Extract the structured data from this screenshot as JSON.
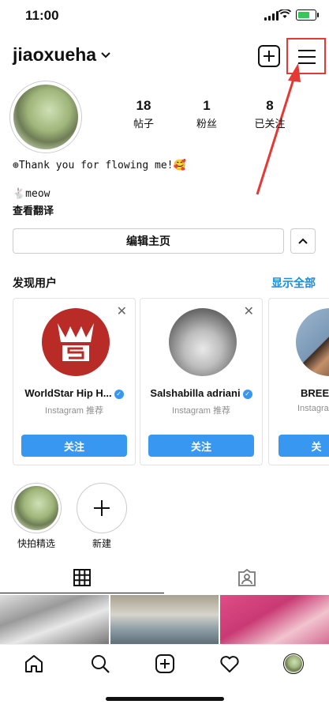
{
  "status": {
    "time": "11:00"
  },
  "header": {
    "username": "jiaoxueha"
  },
  "stats": [
    {
      "value": "18",
      "label": "帖子"
    },
    {
      "value": "1",
      "label": "粉丝"
    },
    {
      "value": "8",
      "label": "已关注"
    }
  ],
  "bio": {
    "line1": "⊕Thank you for flowing me!🥰",
    "line2": "🐇meow",
    "translate": "查看翻译"
  },
  "edit": {
    "label": "编辑主页"
  },
  "discover": {
    "title": "发现用户",
    "see_all": "显示全部"
  },
  "suggestions": [
    {
      "name": "WorldStar Hip H...",
      "sub": "Instagram 推荐",
      "follow": "关注"
    },
    {
      "name": "Salshabilla adriani",
      "sub": "Instagram 推荐",
      "follow": "关注"
    },
    {
      "name": "BREE",
      "sub": "Instagram",
      "follow": "关"
    }
  ],
  "highlights": [
    {
      "label": "快拍精选"
    },
    {
      "label": "新建"
    }
  ],
  "colors": {
    "accent": "#3897f0",
    "highlight_box": "#e53935",
    "link": "#1a8cd8"
  }
}
